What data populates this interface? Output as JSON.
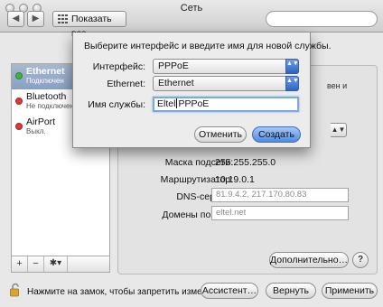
{
  "window": {
    "title": "Сеть"
  },
  "toolbar": {
    "back_icon": "◀",
    "forward_icon": "▶",
    "show_all_label": "Показать все"
  },
  "sidebar": {
    "items": [
      {
        "name": "Ethernet",
        "status": "Подключен",
        "status_color": "#3fb23f",
        "selected": true
      },
      {
        "name": "Bluetooth",
        "status": "Не подключен",
        "status_color": "#d93a3a",
        "selected": false
      },
      {
        "name": "AirPort",
        "status": "Выкл.",
        "status_color": "#d93a3a",
        "selected": false
      }
    ],
    "add_label": "+",
    "remove_label": "−",
    "gear_label": "✱▾"
  },
  "detail": {
    "partial_text_1": "вен и",
    "partial_text_2": "",
    "partial_popup_arrow": "▲▼",
    "subnet_label": "Маска подсети:",
    "subnet_value": "255.255.255.0",
    "router_label": "Маршрутизатор:",
    "router_value": "10.19.0.1",
    "dns_label": "DNS-сервер:",
    "dns_value": "81.9.4.2, 217.170.80.83",
    "domains_label": "Домены поиска:",
    "domains_value": "eltel.net",
    "advanced_button": "Дополнительно…",
    "help_label": "?"
  },
  "bottom": {
    "lock_text": "Нажмите на замок, чтобы запретить изменения.",
    "assistant_button": "Ассистент…",
    "revert_button": "Вернуть",
    "apply_button": "Применить"
  },
  "sheet": {
    "message": "Выберите интерфейс и введите имя для новой службы.",
    "interface_label": "Интерфейс:",
    "interface_value": "PPPoE",
    "ethernet_label": "Ethernet:",
    "ethernet_value": "Ethernet",
    "service_name_label": "Имя службы:",
    "service_name_before_caret": "Eltel",
    "service_name_after_caret": "PPPoE",
    "cancel_button": "Отменить",
    "create_button": "Создать",
    "popup_arrows": "▲▼"
  },
  "colors": {
    "accent": "#4e8ae0",
    "selection": "#8aa0c2"
  }
}
